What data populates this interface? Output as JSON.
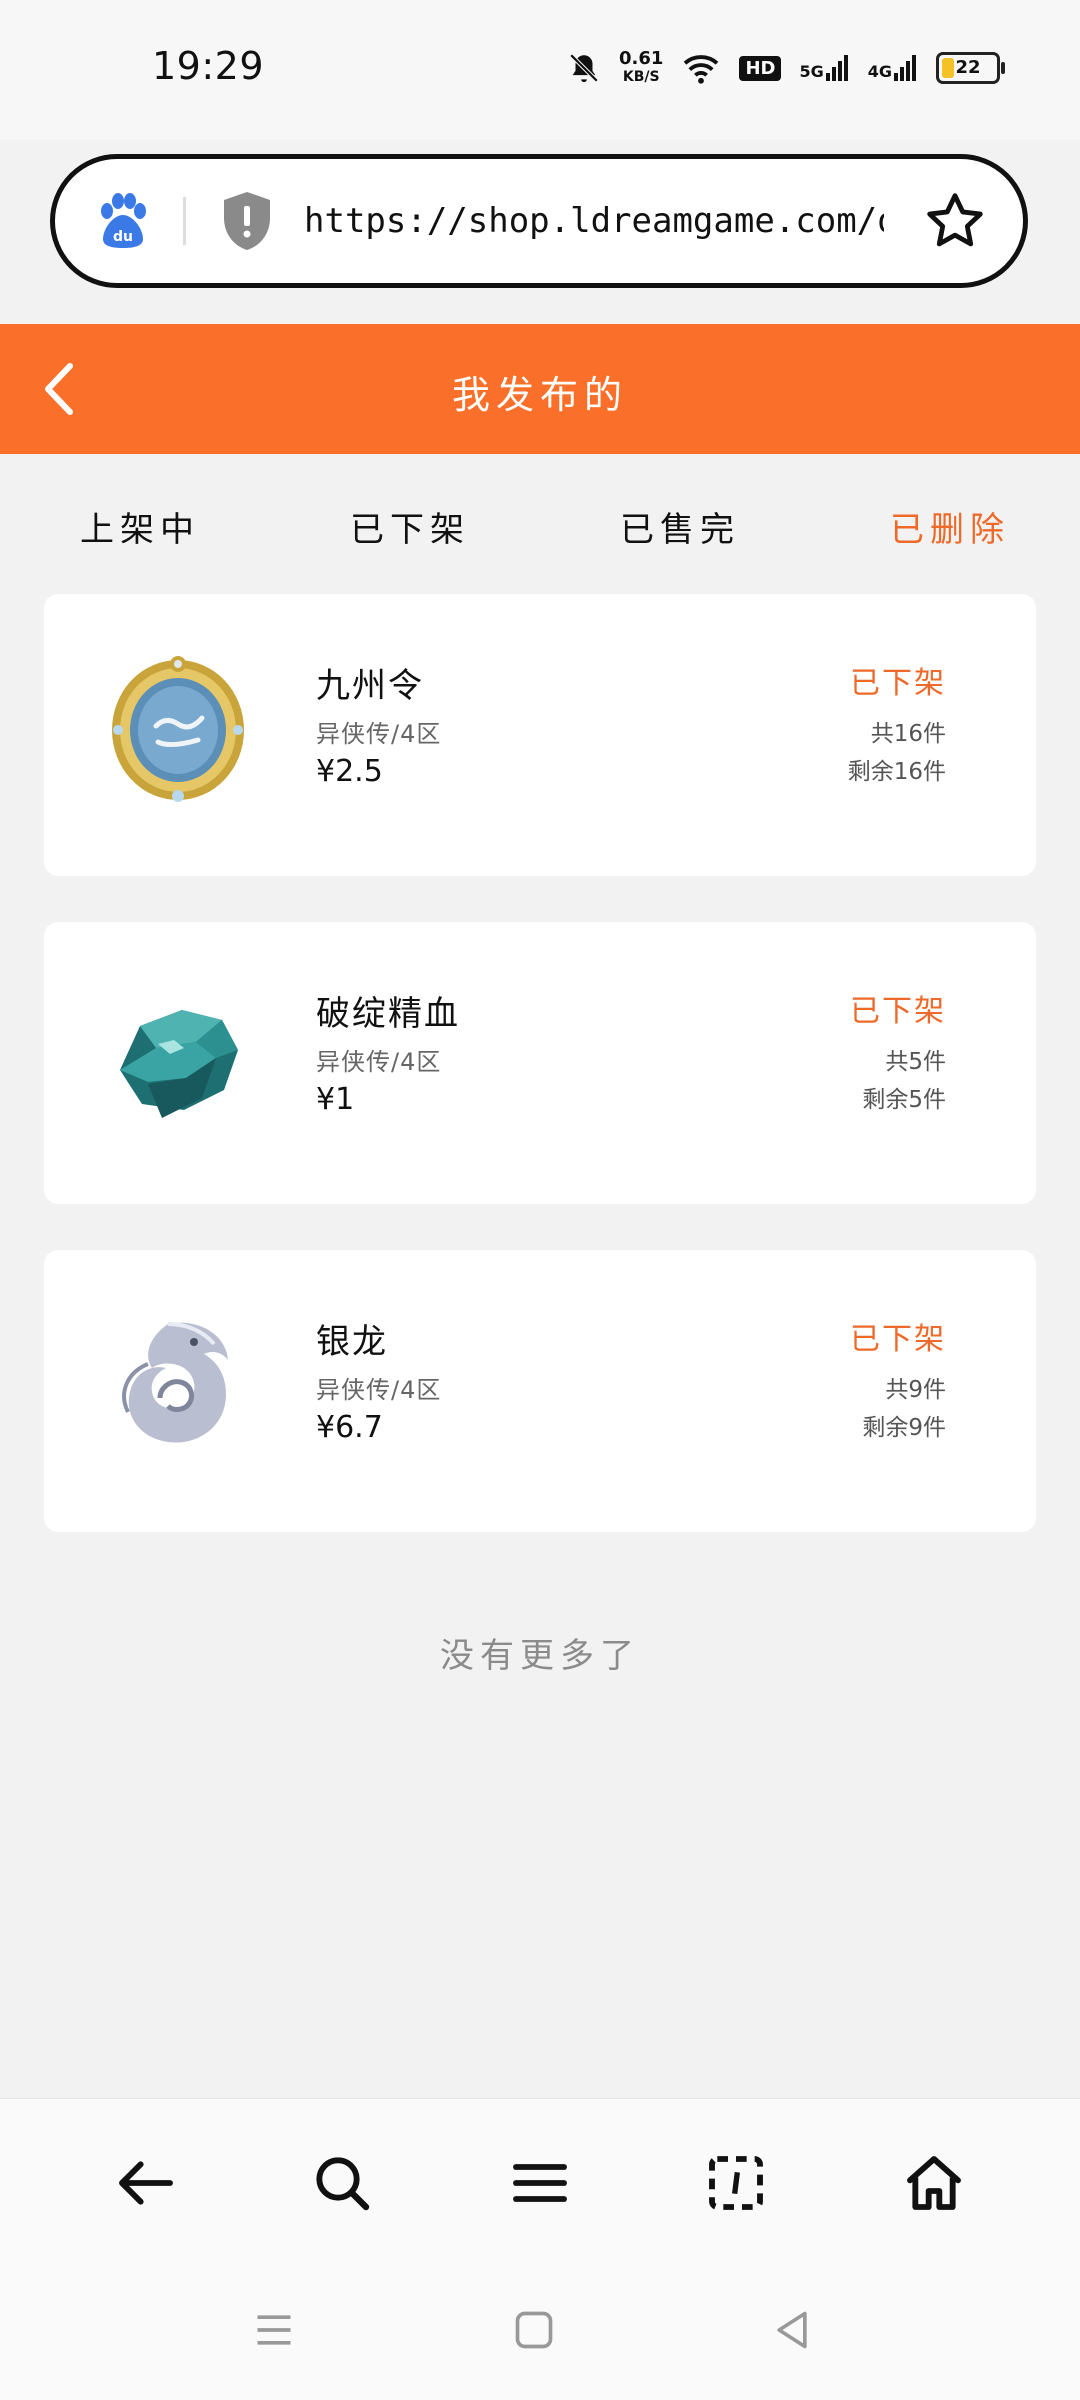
{
  "status_bar": {
    "time": "19:29",
    "speed_value": "0.61",
    "speed_unit": "KB/S",
    "hd_label": "HD",
    "net1": "5G",
    "net2": "4G",
    "battery": "22"
  },
  "browser": {
    "url": "https://shop.ldreamgame.com/o ..."
  },
  "header": {
    "title": "我发布的"
  },
  "tabs": [
    {
      "label": "上架中",
      "active": false
    },
    {
      "label": "已下架",
      "active": false
    },
    {
      "label": "已售完",
      "active": false
    },
    {
      "label": "已删除",
      "active": true
    }
  ],
  "items": [
    {
      "name": "九州令",
      "server": "异侠传/4区",
      "price": "¥2.5",
      "status": "已下架",
      "total": "共16件",
      "remaining": "剩余16件",
      "icon": "medal-icon"
    },
    {
      "name": "破绽精血",
      "server": "异侠传/4区",
      "price": "¥1",
      "status": "已下架",
      "total": "共5件",
      "remaining": "剩余5件",
      "icon": "crystal-icon"
    },
    {
      "name": "银龙",
      "server": "异侠传/4区",
      "price": "¥6.7",
      "status": "已下架",
      "total": "共9件",
      "remaining": "剩余9件",
      "icon": "silver-dragon-icon"
    }
  ],
  "footer_note": "没有更多了",
  "colors": {
    "accent": "#fa6f29",
    "status": "#ee6a2a",
    "background": "#f2f2f2"
  }
}
